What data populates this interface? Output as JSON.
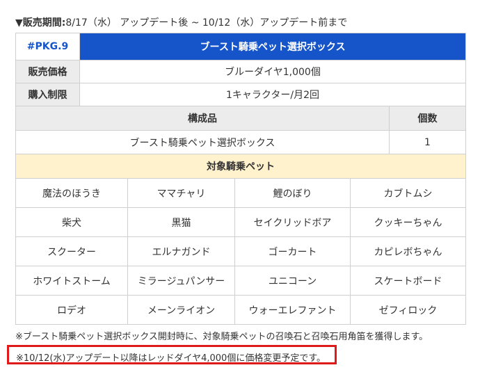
{
  "period": {
    "label": "▼販売期間:",
    "value": "8/17（水） アップデート後 ~ 10/12（水）アップデート前まで"
  },
  "package": {
    "code": "#PKG.9",
    "title": "ブースト騎乗ペット選択ボックス",
    "price_label": "販売価格",
    "price_value": "ブルーダイヤ1,000個",
    "limit_label": "購入制限",
    "limit_value": "1キャラクター/月2回",
    "contents_header": "構成品",
    "count_header": "個数",
    "items": [
      {
        "name": "ブースト騎乗ペット選択ボックス",
        "count": "1"
      }
    ]
  },
  "pets": {
    "header": "対象騎乗ペット",
    "rows": [
      [
        "魔法のほうき",
        "ママチャリ",
        "鯉のぼり",
        "カブトムシ"
      ],
      [
        "柴犬",
        "黒猫",
        "セイクリッドボア",
        "クッキーちゃん"
      ],
      [
        "スクーター",
        "エルナガンド",
        "ゴーカート",
        "カピレボちゃん"
      ],
      [
        "ホワイトストーム",
        "ミラージュパンサー",
        "ユニコーン",
        "スケートボード"
      ],
      [
        "ロデオ",
        "メーンライオン",
        "ウォーエレファント",
        "ゼフィロック"
      ]
    ]
  },
  "notes": {
    "note1": "※ブースト騎乗ペット選択ボックス開封時に、対象騎乗ペットの召喚石と召喚石用角笛を獲得します。",
    "note2": "※10/12(水)アップデート以降はレッドダイヤ4,000個に価格変更予定です。"
  },
  "colors": {
    "title_bg": "#1654c9",
    "label_bg": "#ececec",
    "pets_header_bg": "#fff2cc",
    "highlight_border": "#e01a1a"
  }
}
